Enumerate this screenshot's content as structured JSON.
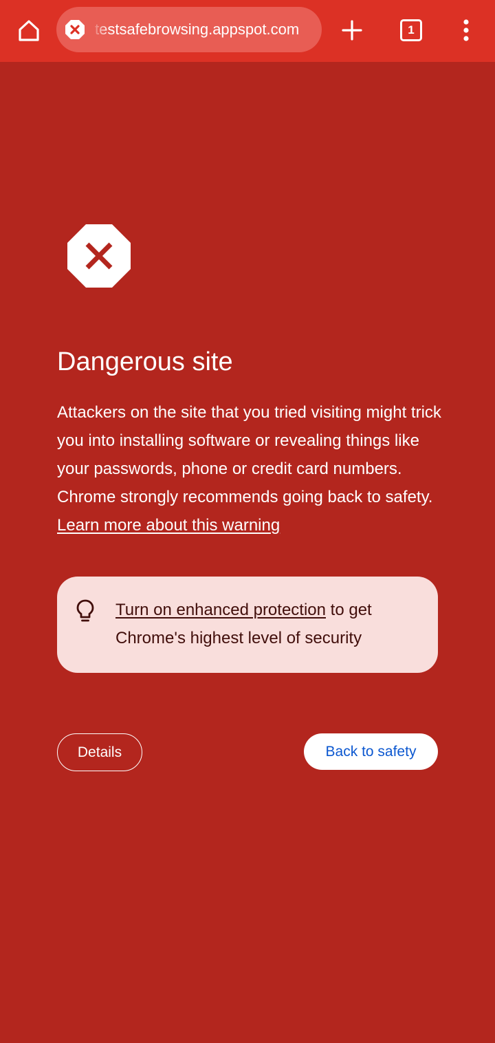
{
  "toolbar": {
    "url": "testsafebrowsing.appspot.com",
    "tab_count": "1",
    "icons": {
      "home": "home-icon",
      "site_status": "dangerous-site-icon",
      "new_tab": "plus-icon",
      "tab_switcher": "tab-switcher-icon",
      "menu": "more-vert-icon"
    }
  },
  "interstitial": {
    "title": "Dangerous site",
    "body": "Attackers on the site that you tried visiting might trick you into installing software or revealing things like your passwords, phone or credit card numbers. Chrome strongly recommends going back to safety.",
    "learn_more_link": "Learn more about this warning",
    "tip": {
      "link": "Turn on enhanced protection",
      "text": "to get Chrome's highest level of security",
      "icon": "lightbulb-icon"
    },
    "details_button": "Details",
    "back_button": "Back to safety"
  },
  "colors": {
    "page_background": "#b3261e",
    "toolbar_background": "#dc3125",
    "omnibox_background": "#e85d54",
    "tip_background": "#f9dedc",
    "tip_text": "#410e0b",
    "primary_button_text": "#0b57d0"
  }
}
